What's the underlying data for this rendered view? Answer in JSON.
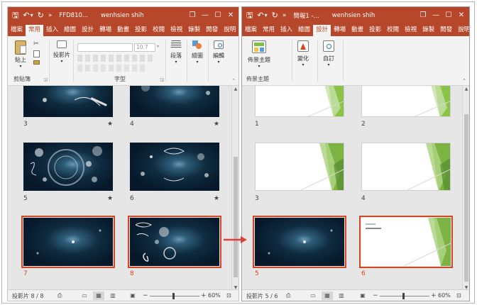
{
  "left": {
    "qa": {
      "save": "🖫",
      "undo": "↶",
      "undo_drop": "▾",
      "redo": "↻",
      "more": "»"
    },
    "title": "FFD810...",
    "user": "wenhsien shih",
    "controls": {
      "restore": "❐",
      "minimize": "—",
      "maximize": "☐",
      "close": "✕"
    },
    "tabs": [
      "檔案",
      "常用",
      "插入",
      "繪圖",
      "設計",
      "轉場",
      "動畫",
      "投影",
      "校閱",
      "檢視",
      "錄製",
      "開發",
      "說明"
    ],
    "active_tab": "常用",
    "ribbon": {
      "paste": "貼上",
      "clipboard": "剪貼簿",
      "slides": "投影片",
      "font_size": "10.7",
      "font_group": "字型",
      "paragraph": "段落",
      "drawing": "繪圖",
      "editing": "編輯"
    },
    "slides": [
      {
        "num": "3",
        "star": "★"
      },
      {
        "num": "4",
        "star": "★"
      },
      {
        "num": "5",
        "star": "★"
      },
      {
        "num": "6",
        "star": "★"
      },
      {
        "num": "7",
        "star": ""
      },
      {
        "num": "8",
        "star": ""
      }
    ],
    "status": {
      "slide_info": "投影片 8 / 8",
      "zoom": "60%"
    }
  },
  "right": {
    "qa": {
      "save": "🖫",
      "undo": "↶",
      "undo_drop": "▾",
      "redo": "↻",
      "more": "»"
    },
    "title": "簡報1 -...",
    "user": "wenhsien shih",
    "controls": {
      "restore": "❐",
      "minimize": "—",
      "maximize": "☐",
      "close": "✕"
    },
    "tabs": [
      "檔案",
      "常用",
      "插入",
      "繪圖",
      "設計",
      "轉場",
      "動畫",
      "投影",
      "校閱",
      "檢視",
      "錄製",
      "開發",
      "說明"
    ],
    "active_tab": "設計",
    "ribbon": {
      "themes": "佈景主題",
      "variants": "變化",
      "customize": "自訂",
      "themes_group": "佈景主題"
    },
    "slides": [
      {
        "num": "1"
      },
      {
        "num": "2"
      },
      {
        "num": "3"
      },
      {
        "num": "4"
      },
      {
        "num": "5"
      },
      {
        "num": "6"
      }
    ],
    "status": {
      "slide_info": "投影片 5 / 6",
      "zoom": "60%"
    }
  },
  "colors": {
    "accent": "#b7472a",
    "selection": "#d24726",
    "green": "#7cc242",
    "arrow": "#e0403a"
  }
}
